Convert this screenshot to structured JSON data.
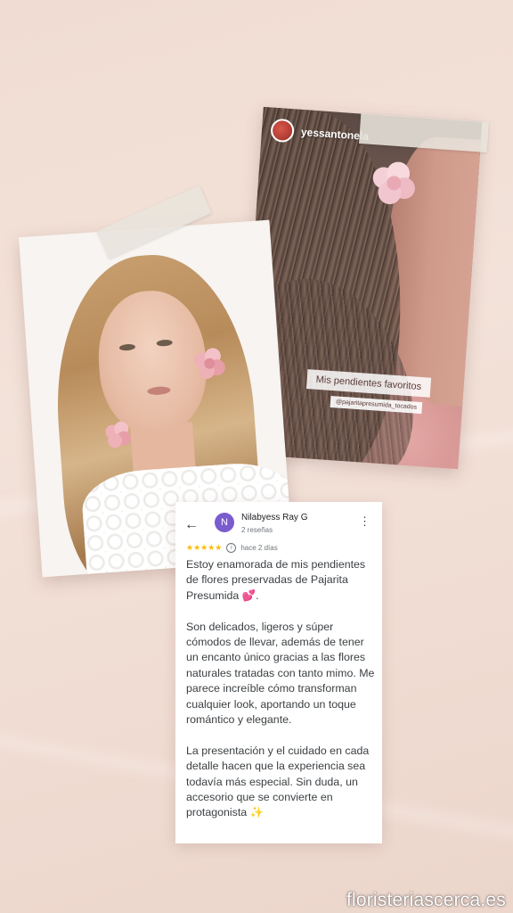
{
  "story": {
    "username": "yessantonela",
    "tag_text": "Mis pendientes favoritos",
    "handle_text": "@pajaritapresumida_tocados"
  },
  "review": {
    "avatar_letter": "N",
    "reviewer_name": "Nilabyess Ray G",
    "reviewer_count": "2 reseñas",
    "stars": "★★★★★",
    "date": "hace 2 días",
    "paragraphs": [
      "Estoy enamorada de mis pendientes de flores preservadas de Pajarita Presumida 💕.",
      "Son delicados, ligeros y súper cómodos de llevar, además de tener un encanto único gracias a las flores naturales tratadas con tanto mimo. Me parece increíble cómo transforman cualquier look, aportando un toque romántico y elegante.",
      "La presentación y el cuidado en cada detalle hacen que la experiencia sea todavía más especial. Sin duda, un accesorio que se convierte en protagonista ✨"
    ],
    "icons": {
      "back": "arrow-left-icon",
      "more": "more-vert-icon",
      "info": "info-icon"
    }
  },
  "watermark": "floristeriascerca.es",
  "colors": {
    "background": "#f0dcd2",
    "avatar_purple": "#7b5ccf",
    "star_yellow": "#fbbc04",
    "flower_pink": "#f2c6cf"
  }
}
